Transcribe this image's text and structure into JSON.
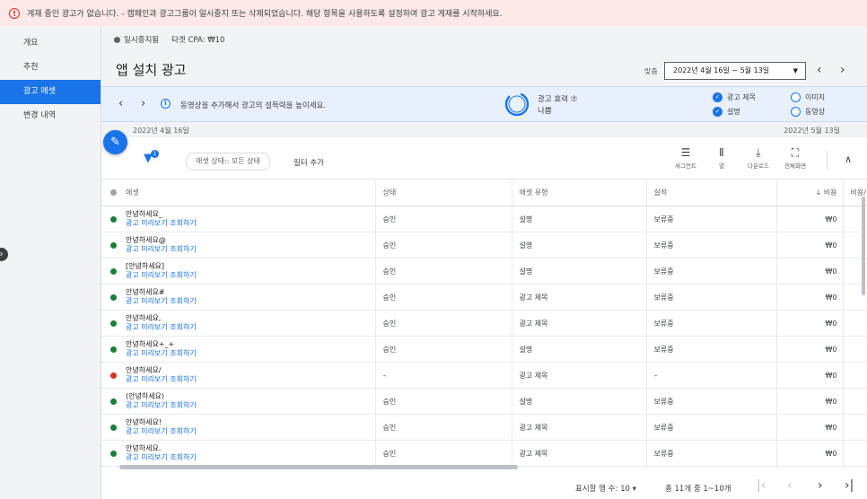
{
  "alert": {
    "icon": "error-icon",
    "text": "게재 중인 광고가 없습니다. - 캠페인과 광고그룹이 일시중지 또는 삭제되었습니다. 해당 항목을 사용하도록 설정하여 광고 게재를 시작하세요."
  },
  "sidebar": {
    "items": [
      {
        "label": "개요"
      },
      {
        "label": "추천"
      },
      {
        "label": "광고 애셋",
        "active": true
      },
      {
        "label": "변경 내역"
      }
    ]
  },
  "status": {
    "label": "일시중지됨",
    "cpa": "타겟 CPA: ₩10"
  },
  "header": {
    "title": "앱 설치 광고",
    "match_label": "맞춤",
    "date_range": "2022년 4월 16일 ~ 5월 13일"
  },
  "panel": {
    "message": "동영상을 추가해서 광고의 설득력을 높이세요.",
    "effect_label": "광고 효력 ⑦",
    "effect_value": "나쁨",
    "checks": [
      {
        "label": "광고 제목",
        "checked": true
      },
      {
        "label": "이미지",
        "checked": false
      },
      {
        "label": "설명",
        "checked": true
      },
      {
        "label": "동영상",
        "checked": false
      }
    ]
  },
  "timeline": {
    "start": "2022년 4월 16일",
    "end": "2022년 5월 13일"
  },
  "filter": {
    "badge": "1",
    "chip": "애셋 상태:: 모든 상태",
    "add_filter": "필터 추가"
  },
  "tools": {
    "segment": "세그먼트",
    "columns": "열",
    "download": "다운로드",
    "fullscreen": "전체화면"
  },
  "table": {
    "headers": [
      "애셋",
      "상태",
      "애셋 유형",
      "실적",
      "↓ 비용",
      "비용/"
    ],
    "preview_link": "광고 미리보기 조회하기",
    "rows": [
      {
        "asset": "안녕하세요_",
        "state": "승인",
        "type": "설명",
        "perf": "보류중",
        "cost": "₩0",
        "ok": true
      },
      {
        "asset": "안녕하세요@",
        "state": "승인",
        "type": "설명",
        "perf": "보류중",
        "cost": "₩0",
        "ok": true
      },
      {
        "asset": "[안녕하세요]",
        "state": "승인",
        "type": "설명",
        "perf": "보류중",
        "cost": "₩0",
        "ok": true
      },
      {
        "asset": "안녕하세요#",
        "state": "승인",
        "type": "광고 제목",
        "perf": "보류중",
        "cost": "₩0",
        "ok": true
      },
      {
        "asset": "안녕하세요,",
        "state": "승인",
        "type": "광고 제목",
        "perf": "보류중",
        "cost": "₩0",
        "ok": true
      },
      {
        "asset": "안녕하세요+_+",
        "state": "승인",
        "type": "설명",
        "perf": "보류중",
        "cost": "₩0",
        "ok": true
      },
      {
        "asset": "안녕하세요/",
        "state": "–",
        "type": "광고 제목",
        "perf": "–",
        "cost": "₩0",
        "ok": false
      },
      {
        "asset": "(안녕하세요)",
        "state": "승인",
        "type": "설명",
        "perf": "보류중",
        "cost": "₩0",
        "ok": true
      },
      {
        "asset": "안녕하세요!",
        "state": "승인",
        "type": "광고 제목",
        "perf": "보류중",
        "cost": "₩0",
        "ok": true
      },
      {
        "asset": "안녕하세요.",
        "state": "승인",
        "type": "광고 제목",
        "perf": "보류중",
        "cost": "₩0",
        "ok": true
      }
    ]
  },
  "pager": {
    "rows_label": "표시할 행 수: 10 ▾",
    "range": "총 11개 중 1~10개"
  },
  "colors": {
    "accent": "#1a73e8",
    "ok": "#188038",
    "error": "#d93025",
    "alert_bg": "#fce8e6"
  }
}
